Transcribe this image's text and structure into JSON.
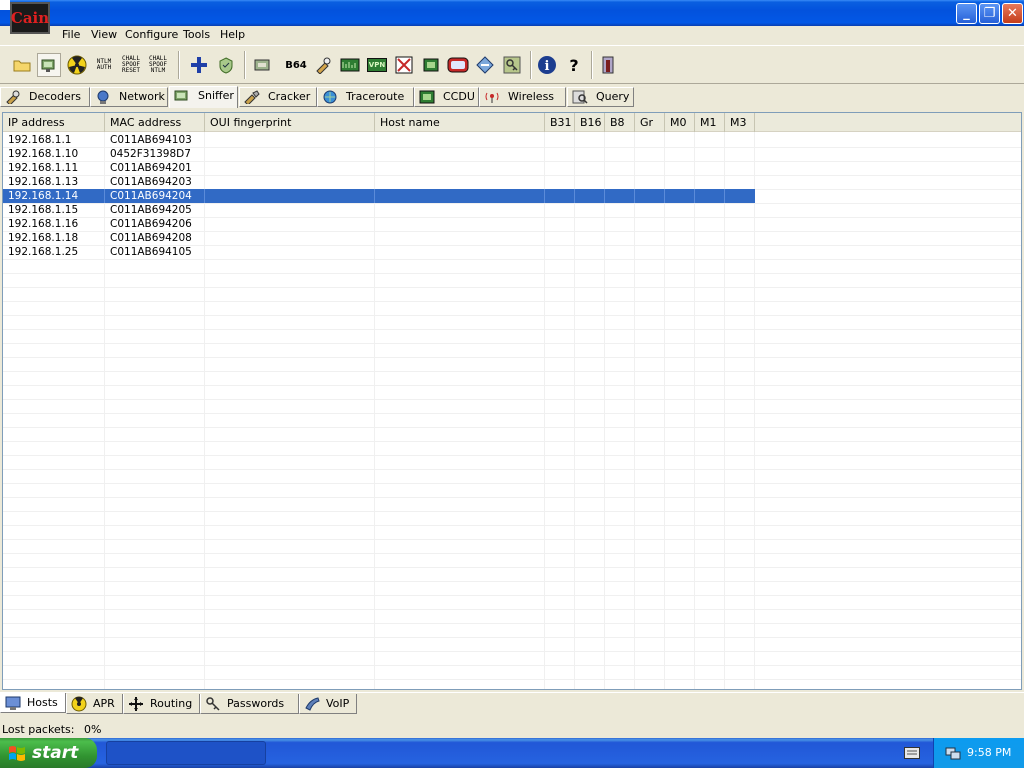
{
  "window": {
    "app_icon_text": "Cain",
    "minimize": "_",
    "maximize": "❐",
    "close": "✕"
  },
  "menu": [
    "File",
    "View",
    "Configure",
    "Tools",
    "Help"
  ],
  "toolbar": {
    "ntlm_auth": "NTLM AUTH",
    "chall_spoof_reset": "CHALL SPOOF RESET",
    "chall_spoof_ntlm": "CHALL SPOOF NTLM",
    "b64": "B64",
    "vpn": "VPN"
  },
  "top_tabs": [
    "Decoders",
    "Network",
    "Sniffer",
    "Cracker",
    "Traceroute",
    "CCDU",
    "Wireless",
    "Query"
  ],
  "active_top_tab": "Sniffer",
  "hosts_table": {
    "columns": [
      "IP address",
      "MAC address",
      "OUI fingerprint",
      "Host name",
      "B31",
      "B16",
      "B8",
      "Gr",
      "M0",
      "M1",
      "M3"
    ],
    "rows": [
      {
        "ip": "192.168.1.1",
        "mac": "C011AB694103"
      },
      {
        "ip": "192.168.1.10",
        "mac": "0452F31398D7"
      },
      {
        "ip": "192.168.1.11",
        "mac": "C011AB694201"
      },
      {
        "ip": "192.168.1.13",
        "mac": "C011AB694203"
      },
      {
        "ip": "192.168.1.14",
        "mac": "C011AB694204"
      },
      {
        "ip": "192.168.1.15",
        "mac": "C011AB694205"
      },
      {
        "ip": "192.168.1.16",
        "mac": "C011AB694206"
      },
      {
        "ip": "192.168.1.18",
        "mac": "C011AB694208"
      },
      {
        "ip": "192.168.1.25",
        "mac": "C011AB694105"
      }
    ],
    "selected_ip": "192.168.1.14"
  },
  "bottom_tabs": [
    "Hosts",
    "APR",
    "Routing",
    "Passwords",
    "VoIP"
  ],
  "active_bottom_tab": "Hosts",
  "status": {
    "lost_packets_label": "Lost packets:",
    "lost_packets_value": "0%"
  },
  "taskbar": {
    "start_label": "start",
    "clock": "9:58 PM"
  },
  "colors": {
    "selection": "#316ac5",
    "titlebar": "#0352dd",
    "start_green": "#319431"
  }
}
